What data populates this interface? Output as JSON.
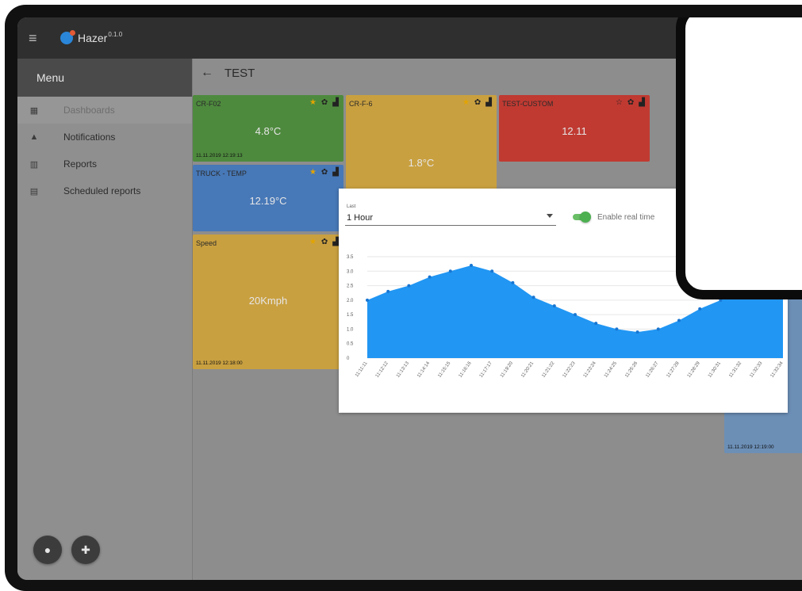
{
  "app": {
    "name": "Hazer",
    "version": "0.1.0"
  },
  "sidebar": {
    "header": "Menu",
    "items": [
      {
        "label": "Dashboards",
        "icon": "dashboard-icon",
        "active": true
      },
      {
        "label": "Notifications",
        "icon": "bell-icon"
      },
      {
        "label": "Reports",
        "icon": "bar-chart-icon"
      },
      {
        "label": "Scheduled reports",
        "icon": "calendar-icon"
      }
    ]
  },
  "page": {
    "title": "TEST"
  },
  "tiles": [
    {
      "name": "CR-F02",
      "value": "4.8°C",
      "time": "11.11.2019 12:19:13",
      "color": "#4e8a3e"
    },
    {
      "name": "CR-F-6",
      "value": "1.8°C",
      "color": "#c9a040"
    },
    {
      "name": "TEST-CUSTOM",
      "value": "12.11",
      "color": "#c03a32"
    },
    {
      "name": "TRUCK - TEMP",
      "value": "12.19°C",
      "color": "#4778b7"
    },
    {
      "name": "Speed",
      "value": "20Kmph",
      "time": "11.11.2019 12:18:00",
      "color": "#c9a040"
    },
    {
      "time": "11.11.2019 12:19:00",
      "color": "#6c8fb6"
    }
  ],
  "chart_panel": {
    "range_label": "Last",
    "range_value": "1 Hour",
    "toggle_label": "Enable real time",
    "toggle_on": true
  },
  "chart_data": {
    "type": "area",
    "x": [
      "11:11:11",
      "11:12:12",
      "11:13:13",
      "11:14:14",
      "11:15:15",
      "11:16:16",
      "11:17:17",
      "11:19:20",
      "11:20:21",
      "11:21:22",
      "11:22:23",
      "11:23:24",
      "11:24:25",
      "11:25:26",
      "11:26:27",
      "11:27:28",
      "11:28:29",
      "11:30:31",
      "11:31:32",
      "11:32:33",
      "11:33:34"
    ],
    "values": [
      2.0,
      2.3,
      2.5,
      2.8,
      3.0,
      3.2,
      3.0,
      2.6,
      2.1,
      1.8,
      1.5,
      1.2,
      1.0,
      0.9,
      1.0,
      1.3,
      1.7,
      2.0,
      2.3,
      2.6,
      2.9
    ],
    "yticks": [
      "3.5",
      "3.0",
      "2.5",
      "2.0",
      "1.5",
      "1.0",
      "0.5",
      "0"
    ],
    "ylim": [
      0,
      3.5
    ],
    "grid": true,
    "color": "#2196f3"
  }
}
